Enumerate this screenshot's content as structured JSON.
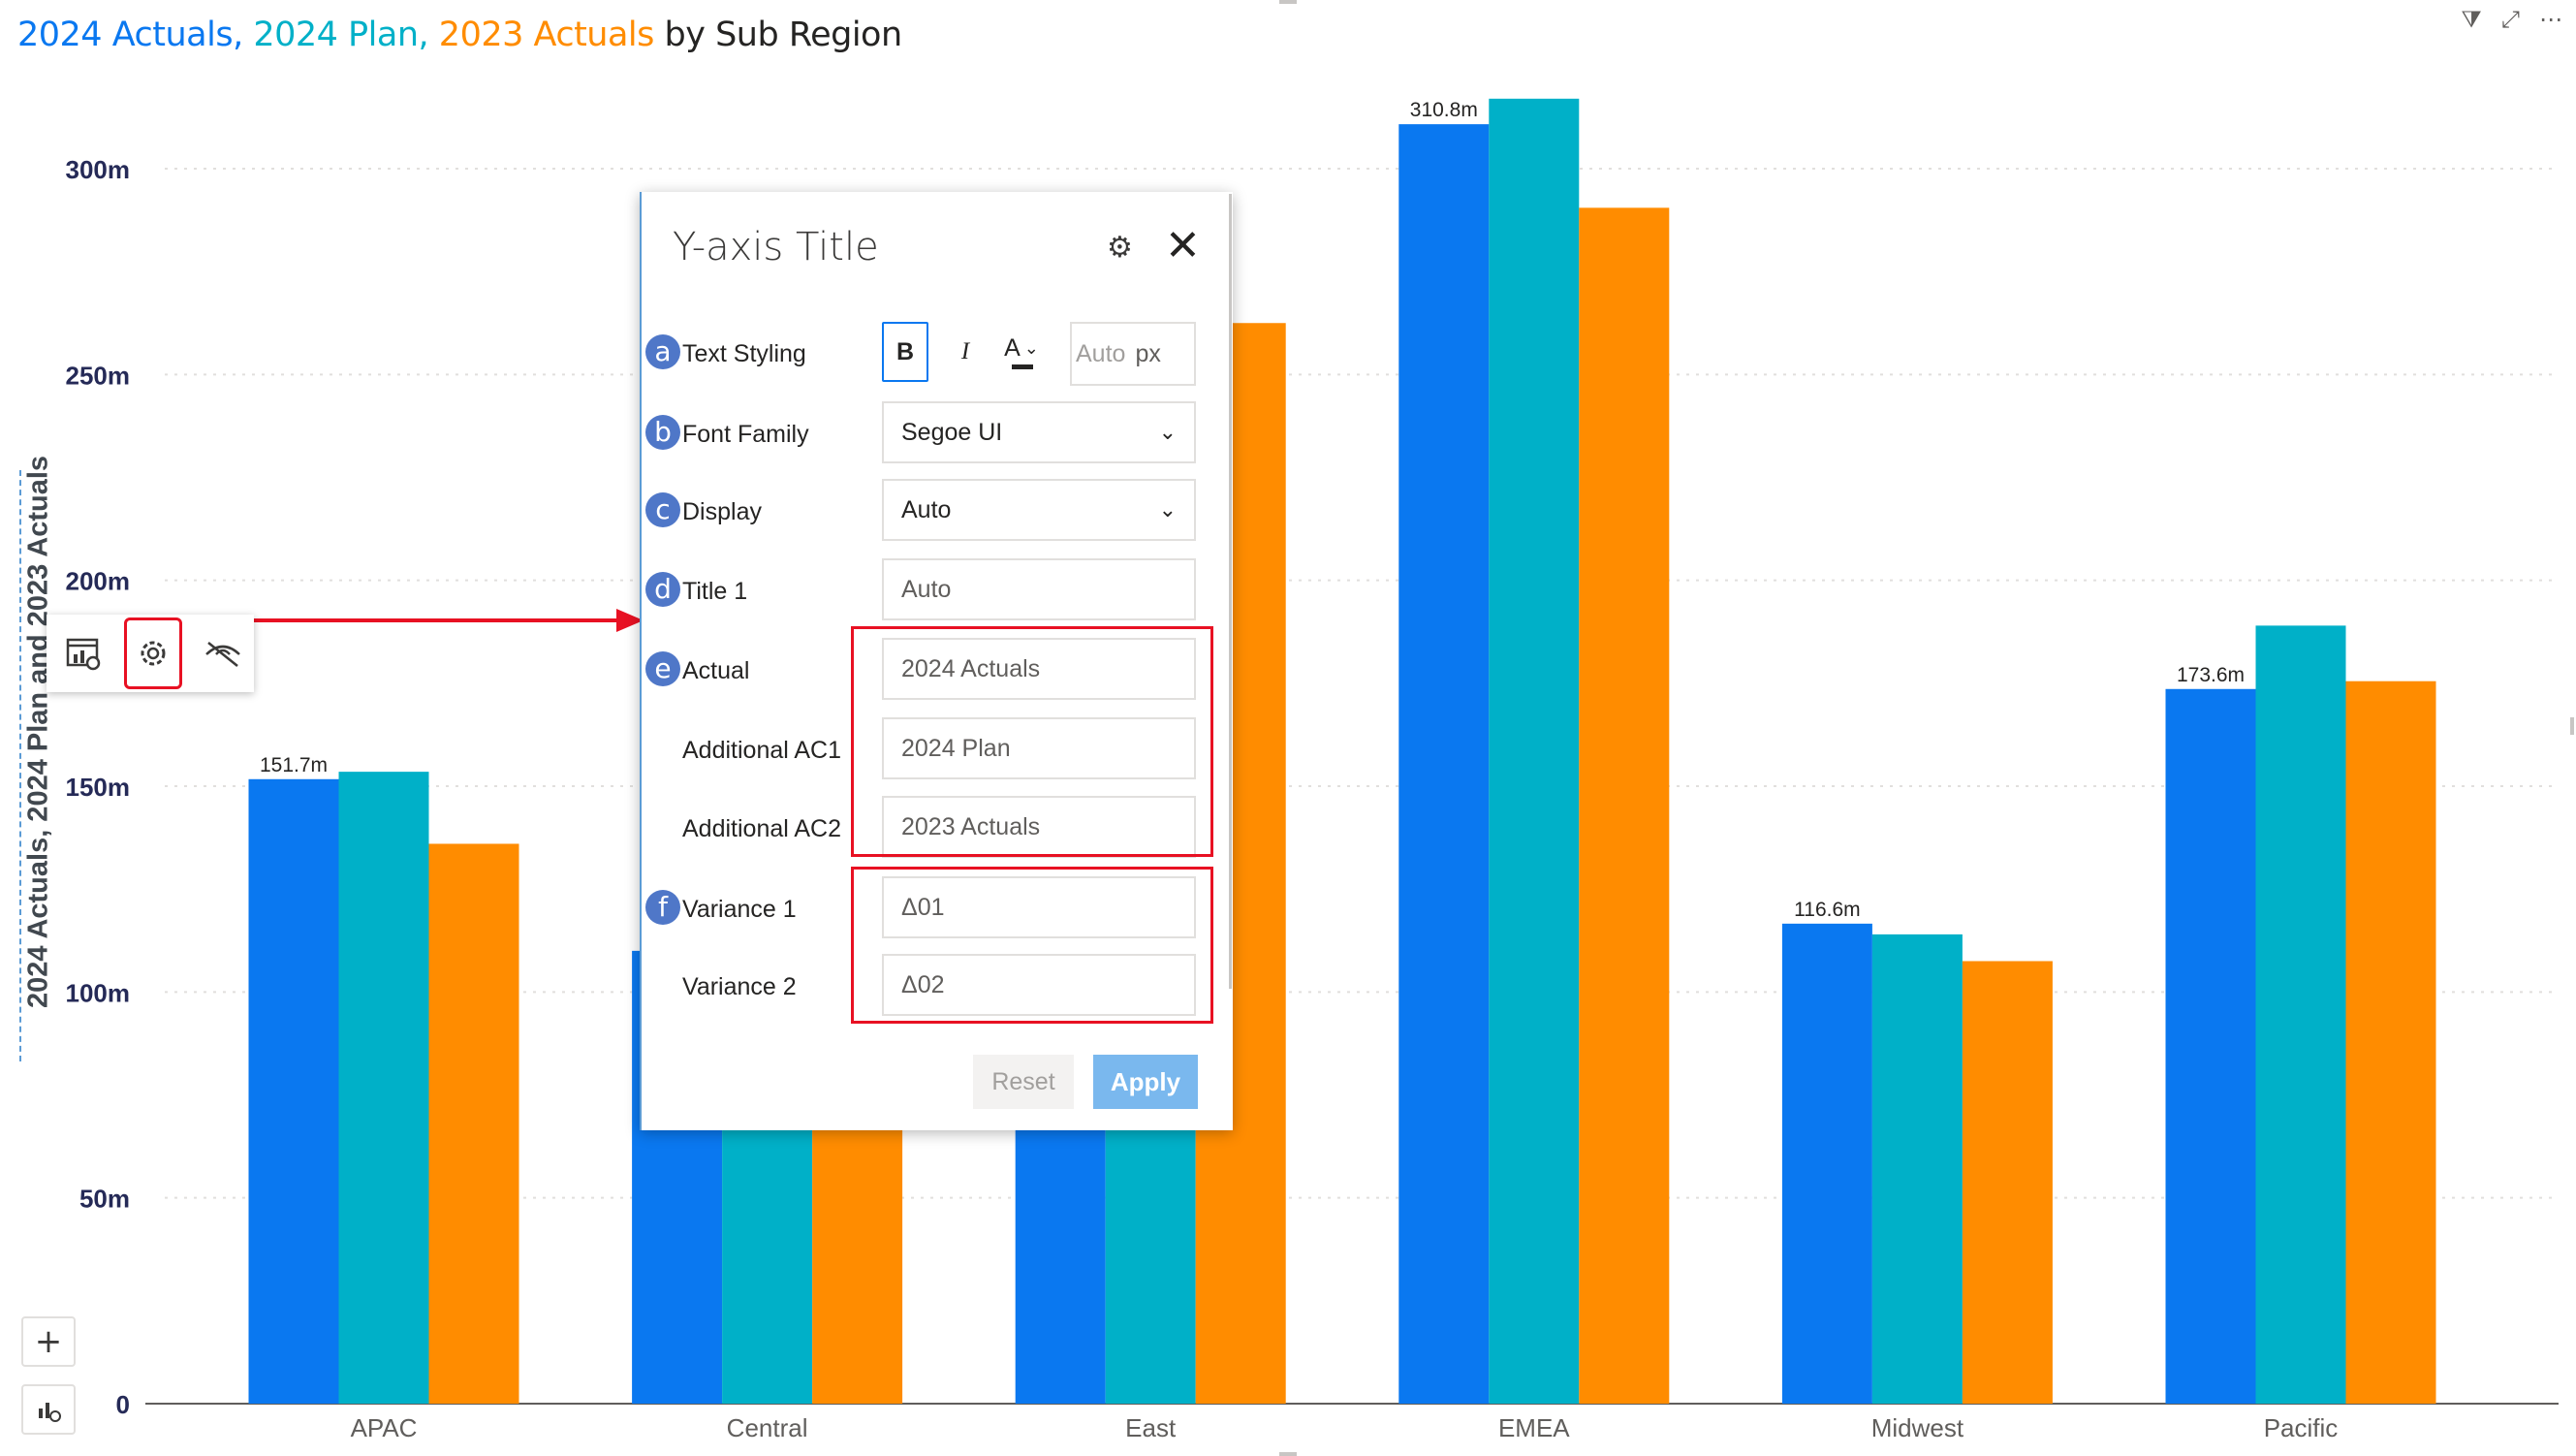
{
  "title": {
    "series_a": "2024 Actuals,",
    "series_b": "2024 Plan,",
    "series_c": "2023 Actuals",
    "rest": "by Sub Region"
  },
  "header_icons": {
    "filter": "⧩",
    "focus": "⤢",
    "more": "⋯"
  },
  "y_axis_title": "2024 Actuals, 2024 Plan and 2023 Actuals",
  "mini_toolbar": {
    "chart_icon": "chart-settings-icon",
    "gear_icon": "gear-icon",
    "hide_icon": "eye-off-icon"
  },
  "panel": {
    "title": "Y-axis Title",
    "rows": {
      "a": {
        "badge": "a",
        "label": "Text Styling"
      },
      "b": {
        "badge": "b",
        "label": "Font Family",
        "value": "Segoe UI"
      },
      "c": {
        "badge": "c",
        "label": "Display",
        "value": "Auto"
      },
      "d": {
        "badge": "d",
        "label": "Title 1",
        "placeholder": "Auto"
      },
      "e": {
        "badge": "e",
        "label": "Actual",
        "placeholder": "2024 Actuals"
      },
      "ac1": {
        "label": "Additional AC1",
        "placeholder": "2024 Plan"
      },
      "ac2": {
        "label": "Additional AC2",
        "placeholder": "2023 Actuals"
      },
      "f": {
        "badge": "f",
        "label": "Variance 1",
        "placeholder": "Δ01"
      },
      "v2": {
        "label": "Variance 2",
        "placeholder": "Δ02"
      }
    },
    "styling": {
      "bold": "B",
      "italic": "I",
      "color": "A",
      "size_placeholder": "Auto",
      "size_unit": "px"
    },
    "reset_label": "Reset",
    "apply_label": "Apply"
  },
  "colors": {
    "actual_2024": "#0a78f0",
    "plan_2024": "#00b0c8",
    "actual_2023": "#ff8c00",
    "highlight": "#e81123"
  },
  "chart_data": {
    "type": "bar",
    "categories": [
      "APAC",
      "Central",
      "East",
      "EMEA",
      "Midwest",
      "Pacific"
    ],
    "series": [
      {
        "name": "2024 Actuals",
        "values": [
          151.7,
          110,
          110,
          310.8,
          116.6,
          173.6
        ]
      },
      {
        "name": "2024 Plan",
        "values": [
          153.5,
          110,
          110,
          317,
          114,
          189
        ]
      },
      {
        "name": "2023 Actuals",
        "values": [
          136,
          110,
          262.5,
          290.5,
          107.5,
          175.5
        ]
      }
    ],
    "data_labels": [
      "151.7m",
      "",
      "",
      "310.8m",
      "116.6m",
      "173.6m"
    ],
    "y_ticks": [
      "0",
      "50m",
      "100m",
      "150m",
      "200m",
      "250m",
      "300m"
    ],
    "ylim": [
      0,
      330
    ],
    "grid": true
  }
}
